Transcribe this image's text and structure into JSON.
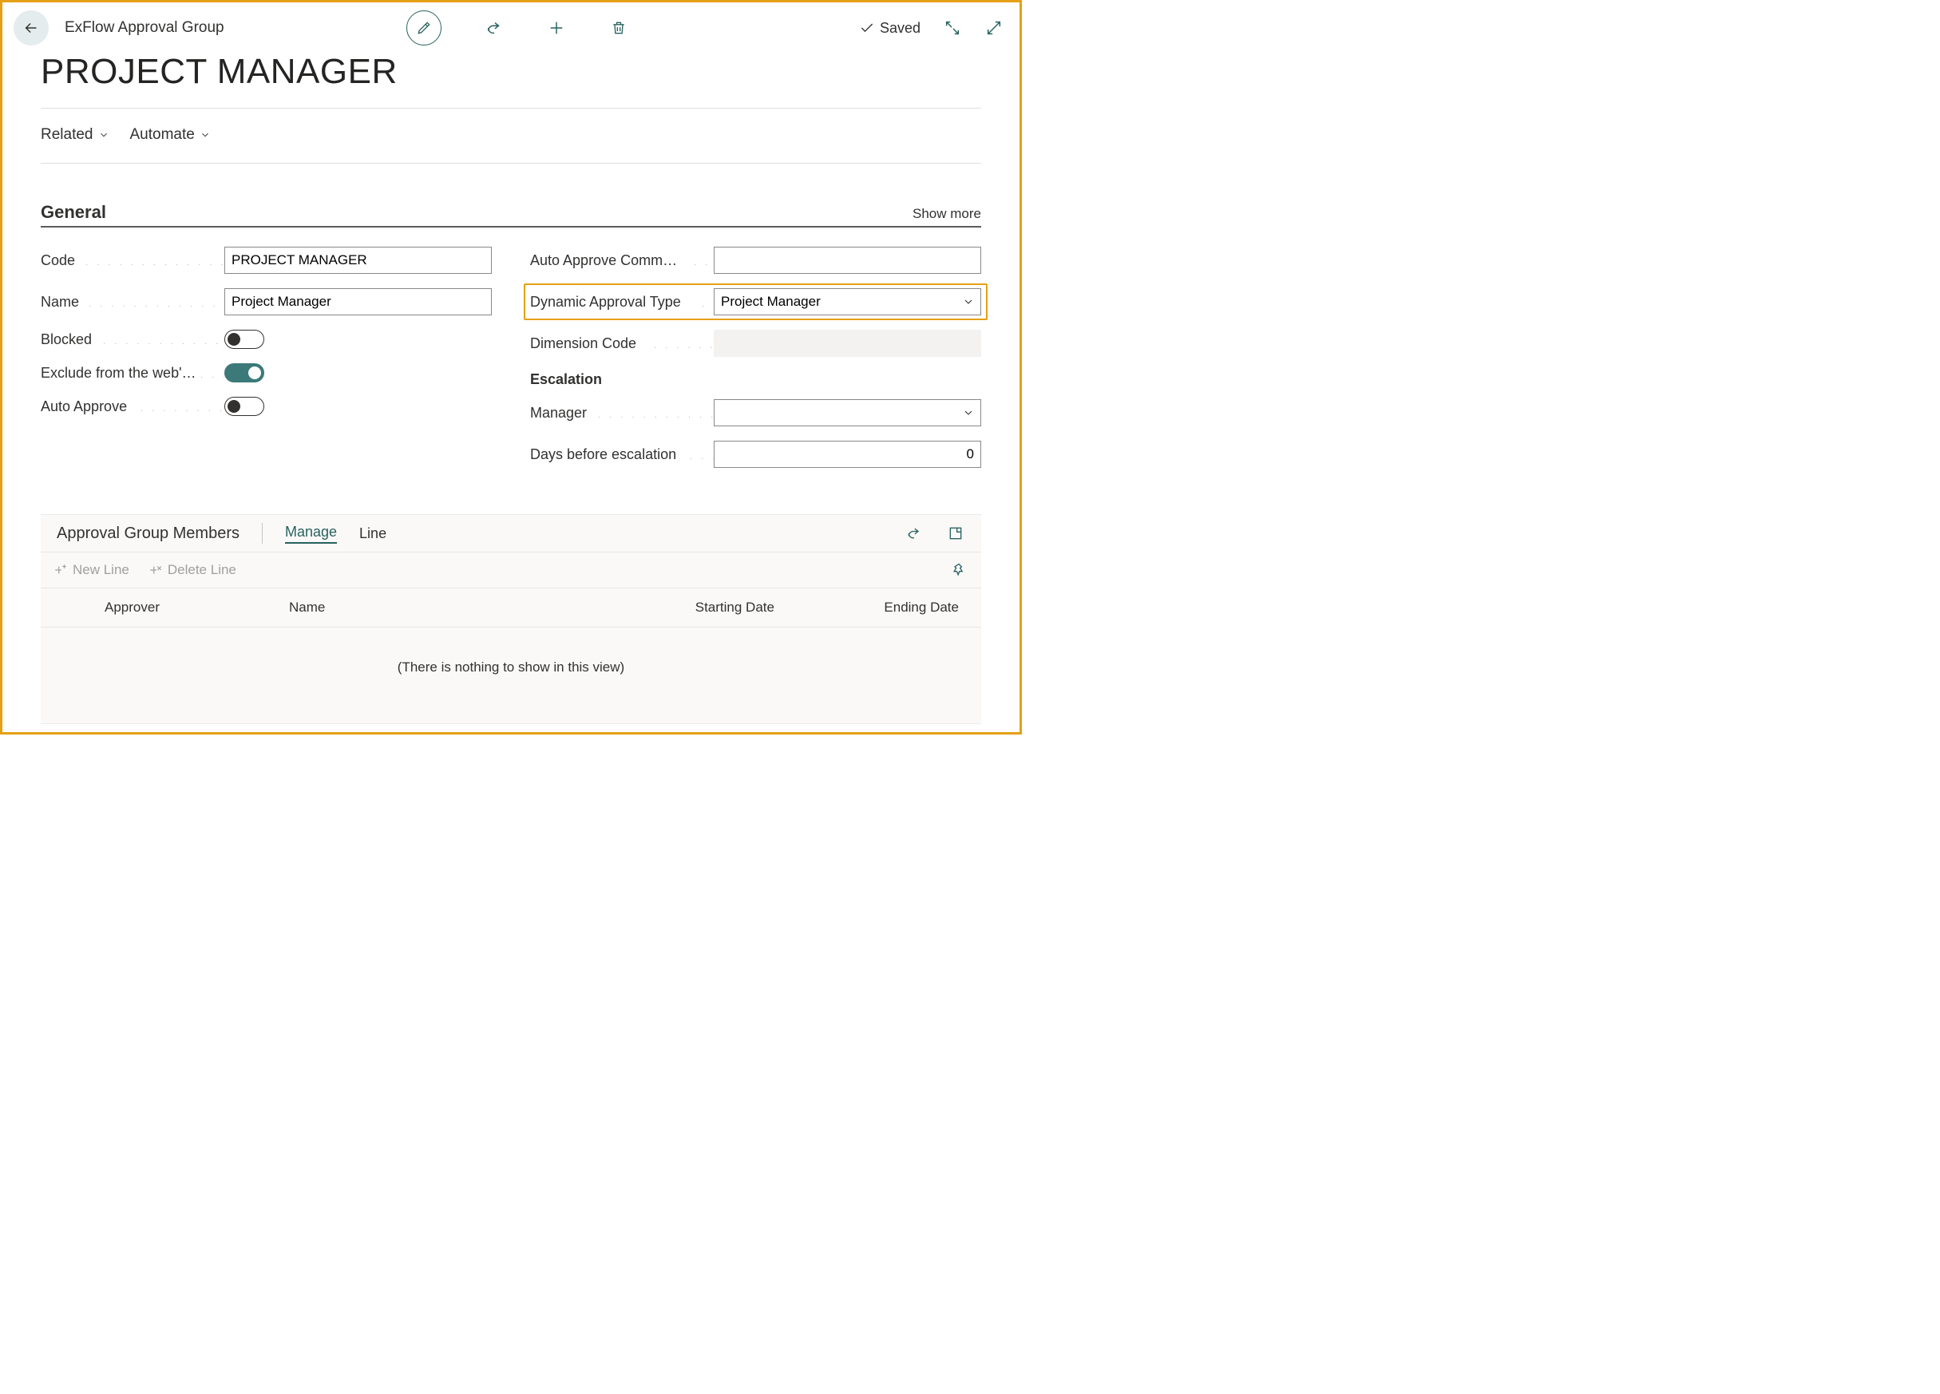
{
  "header": {
    "breadcrumb": "ExFlow Approval Group",
    "saved_label": "Saved"
  },
  "page": {
    "title": "PROJECT MANAGER"
  },
  "menu": {
    "related": "Related",
    "automate": "Automate"
  },
  "section_general": {
    "title": "General",
    "show_more": "Show more",
    "fields": {
      "code_label": "Code",
      "code_value": "PROJECT MANAGER",
      "name_label": "Name",
      "name_value": "Project Manager",
      "blocked_label": "Blocked",
      "blocked_value": false,
      "exclude_label": "Exclude from the web'…",
      "exclude_value": true,
      "auto_approve_label": "Auto Approve",
      "auto_approve_value": false,
      "auto_approve_comm_label": "Auto Approve Comm…",
      "auto_approve_comm_value": "",
      "dynamic_type_label": "Dynamic Approval Type",
      "dynamic_type_value": "Project Manager",
      "dimension_code_label": "Dimension Code",
      "dimension_code_value": ""
    },
    "escalation": {
      "title": "Escalation",
      "manager_label": "Manager",
      "manager_value": "",
      "days_label": "Days before escalation",
      "days_value": "0"
    }
  },
  "members": {
    "title": "Approval Group Members",
    "tab_manage": "Manage",
    "tab_line": "Line",
    "new_line": "New Line",
    "delete_line": "Delete Line",
    "columns": {
      "approver": "Approver",
      "name": "Name",
      "starting": "Starting Date",
      "ending": "Ending Date"
    },
    "empty": "(There is nothing to show in this view)"
  }
}
